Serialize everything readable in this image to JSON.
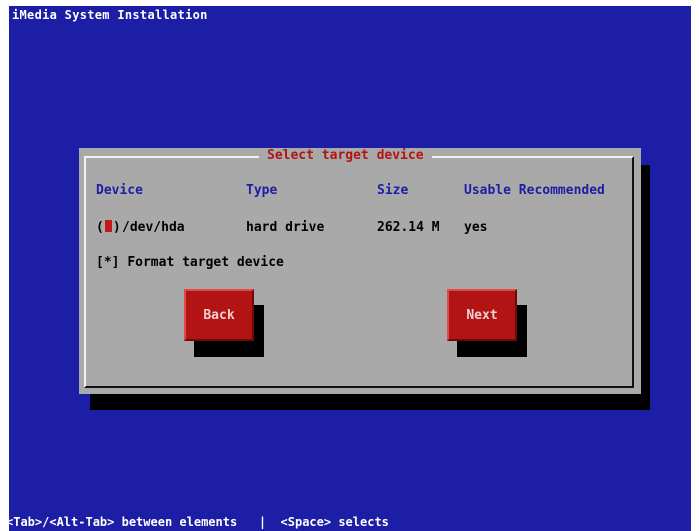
{
  "app": {
    "title": "iMedia System Installation"
  },
  "dialog": {
    "title": "Select target device",
    "columns": {
      "device": "Device",
      "type": "Type",
      "size": "Size",
      "usable": "Usable Recommended"
    },
    "row": {
      "radio_open": "(",
      "radio_close": ")",
      "device": "/dev/hda",
      "type": "hard drive",
      "size": "262.14 M",
      "usable": "yes",
      "selected": true
    },
    "format_checkbox": {
      "box": "[*]",
      "label": "Format target device",
      "checked": true
    },
    "buttons": {
      "back": "Back",
      "next": "Next"
    }
  },
  "status_bar": {
    "text": "<Tab>/<Alt-Tab> between elements   |  <Space> selects"
  },
  "colors": {
    "background": "#1c1ea6",
    "dialog": "#a9a9a9",
    "accent_red": "#b21414",
    "header_blue": "#1c1ea6"
  }
}
